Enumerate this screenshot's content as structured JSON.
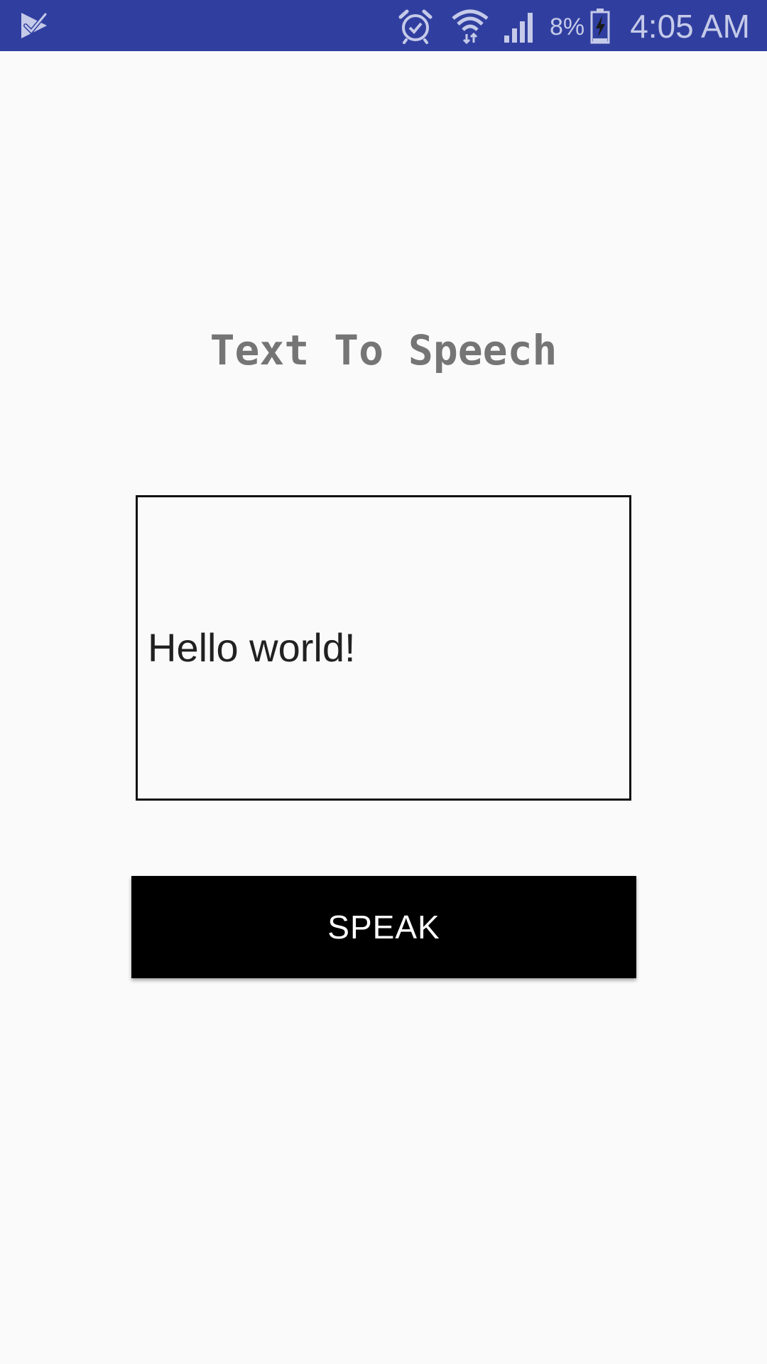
{
  "status_bar": {
    "battery_percent": "8%",
    "time": "4:05 AM",
    "background_color": "#303f9f",
    "icon_color": "#c5cae9",
    "icons": [
      "check-notification-icon",
      "alarm-icon",
      "wifi-icon",
      "signal-icon",
      "battery-charging-icon"
    ]
  },
  "main": {
    "title": "Text To Speech",
    "text_input": {
      "value": "Hello world!"
    },
    "speak_button_label": "SPEAK"
  },
  "colors": {
    "background": "#fafafa",
    "title": "#757575",
    "button_background": "#000000",
    "button_text": "#ffffff"
  }
}
